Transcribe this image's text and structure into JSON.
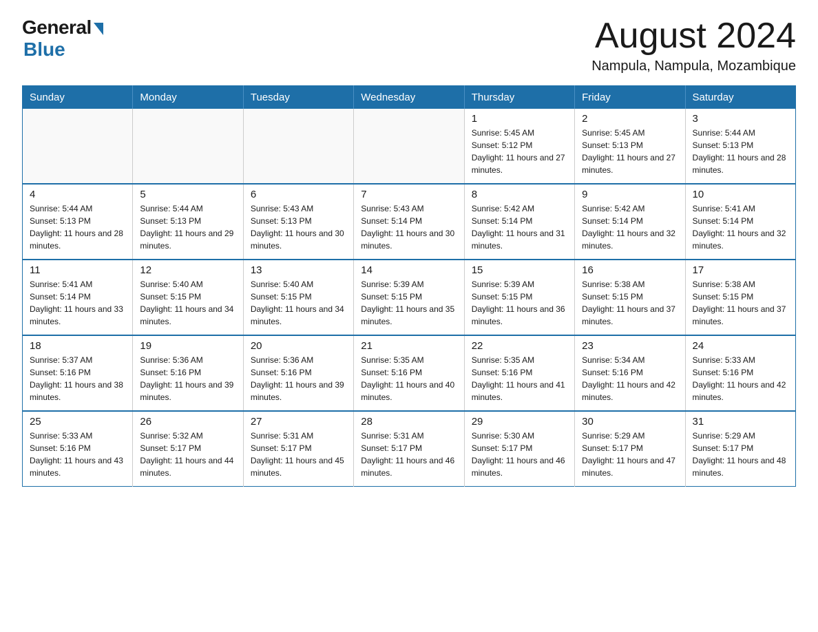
{
  "header": {
    "logo_general": "General",
    "logo_blue": "Blue",
    "month_title": "August 2024",
    "location": "Nampula, Nampula, Mozambique"
  },
  "weekdays": [
    "Sunday",
    "Monday",
    "Tuesday",
    "Wednesday",
    "Thursday",
    "Friday",
    "Saturday"
  ],
  "weeks": [
    [
      {
        "day": "",
        "info": ""
      },
      {
        "day": "",
        "info": ""
      },
      {
        "day": "",
        "info": ""
      },
      {
        "day": "",
        "info": ""
      },
      {
        "day": "1",
        "info": "Sunrise: 5:45 AM\nSunset: 5:12 PM\nDaylight: 11 hours and 27 minutes."
      },
      {
        "day": "2",
        "info": "Sunrise: 5:45 AM\nSunset: 5:13 PM\nDaylight: 11 hours and 27 minutes."
      },
      {
        "day": "3",
        "info": "Sunrise: 5:44 AM\nSunset: 5:13 PM\nDaylight: 11 hours and 28 minutes."
      }
    ],
    [
      {
        "day": "4",
        "info": "Sunrise: 5:44 AM\nSunset: 5:13 PM\nDaylight: 11 hours and 28 minutes."
      },
      {
        "day": "5",
        "info": "Sunrise: 5:44 AM\nSunset: 5:13 PM\nDaylight: 11 hours and 29 minutes."
      },
      {
        "day": "6",
        "info": "Sunrise: 5:43 AM\nSunset: 5:13 PM\nDaylight: 11 hours and 30 minutes."
      },
      {
        "day": "7",
        "info": "Sunrise: 5:43 AM\nSunset: 5:14 PM\nDaylight: 11 hours and 30 minutes."
      },
      {
        "day": "8",
        "info": "Sunrise: 5:42 AM\nSunset: 5:14 PM\nDaylight: 11 hours and 31 minutes."
      },
      {
        "day": "9",
        "info": "Sunrise: 5:42 AM\nSunset: 5:14 PM\nDaylight: 11 hours and 32 minutes."
      },
      {
        "day": "10",
        "info": "Sunrise: 5:41 AM\nSunset: 5:14 PM\nDaylight: 11 hours and 32 minutes."
      }
    ],
    [
      {
        "day": "11",
        "info": "Sunrise: 5:41 AM\nSunset: 5:14 PM\nDaylight: 11 hours and 33 minutes."
      },
      {
        "day": "12",
        "info": "Sunrise: 5:40 AM\nSunset: 5:15 PM\nDaylight: 11 hours and 34 minutes."
      },
      {
        "day": "13",
        "info": "Sunrise: 5:40 AM\nSunset: 5:15 PM\nDaylight: 11 hours and 34 minutes."
      },
      {
        "day": "14",
        "info": "Sunrise: 5:39 AM\nSunset: 5:15 PM\nDaylight: 11 hours and 35 minutes."
      },
      {
        "day": "15",
        "info": "Sunrise: 5:39 AM\nSunset: 5:15 PM\nDaylight: 11 hours and 36 minutes."
      },
      {
        "day": "16",
        "info": "Sunrise: 5:38 AM\nSunset: 5:15 PM\nDaylight: 11 hours and 37 minutes."
      },
      {
        "day": "17",
        "info": "Sunrise: 5:38 AM\nSunset: 5:15 PM\nDaylight: 11 hours and 37 minutes."
      }
    ],
    [
      {
        "day": "18",
        "info": "Sunrise: 5:37 AM\nSunset: 5:16 PM\nDaylight: 11 hours and 38 minutes."
      },
      {
        "day": "19",
        "info": "Sunrise: 5:36 AM\nSunset: 5:16 PM\nDaylight: 11 hours and 39 minutes."
      },
      {
        "day": "20",
        "info": "Sunrise: 5:36 AM\nSunset: 5:16 PM\nDaylight: 11 hours and 39 minutes."
      },
      {
        "day": "21",
        "info": "Sunrise: 5:35 AM\nSunset: 5:16 PM\nDaylight: 11 hours and 40 minutes."
      },
      {
        "day": "22",
        "info": "Sunrise: 5:35 AM\nSunset: 5:16 PM\nDaylight: 11 hours and 41 minutes."
      },
      {
        "day": "23",
        "info": "Sunrise: 5:34 AM\nSunset: 5:16 PM\nDaylight: 11 hours and 42 minutes."
      },
      {
        "day": "24",
        "info": "Sunrise: 5:33 AM\nSunset: 5:16 PM\nDaylight: 11 hours and 42 minutes."
      }
    ],
    [
      {
        "day": "25",
        "info": "Sunrise: 5:33 AM\nSunset: 5:16 PM\nDaylight: 11 hours and 43 minutes."
      },
      {
        "day": "26",
        "info": "Sunrise: 5:32 AM\nSunset: 5:17 PM\nDaylight: 11 hours and 44 minutes."
      },
      {
        "day": "27",
        "info": "Sunrise: 5:31 AM\nSunset: 5:17 PM\nDaylight: 11 hours and 45 minutes."
      },
      {
        "day": "28",
        "info": "Sunrise: 5:31 AM\nSunset: 5:17 PM\nDaylight: 11 hours and 46 minutes."
      },
      {
        "day": "29",
        "info": "Sunrise: 5:30 AM\nSunset: 5:17 PM\nDaylight: 11 hours and 46 minutes."
      },
      {
        "day": "30",
        "info": "Sunrise: 5:29 AM\nSunset: 5:17 PM\nDaylight: 11 hours and 47 minutes."
      },
      {
        "day": "31",
        "info": "Sunrise: 5:29 AM\nSunset: 5:17 PM\nDaylight: 11 hours and 48 minutes."
      }
    ]
  ]
}
